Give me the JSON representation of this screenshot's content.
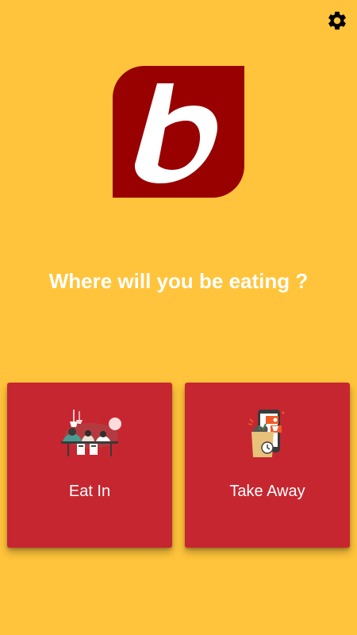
{
  "theme": {
    "background": "#FFC43B",
    "brand_red": "#990000",
    "card_red": "#C62630",
    "text_color": "#FFFFFF"
  },
  "header": {
    "settings_icon": "gear-icon"
  },
  "logo": {
    "letter": "b",
    "icon": "brand-logo"
  },
  "main": {
    "question": "Where will you be eating ?"
  },
  "options": [
    {
      "label": "Eat In",
      "icon": "dining-table-illustration"
    },
    {
      "label": "Take Away",
      "icon": "takeaway-bag-phone-illustration"
    }
  ]
}
